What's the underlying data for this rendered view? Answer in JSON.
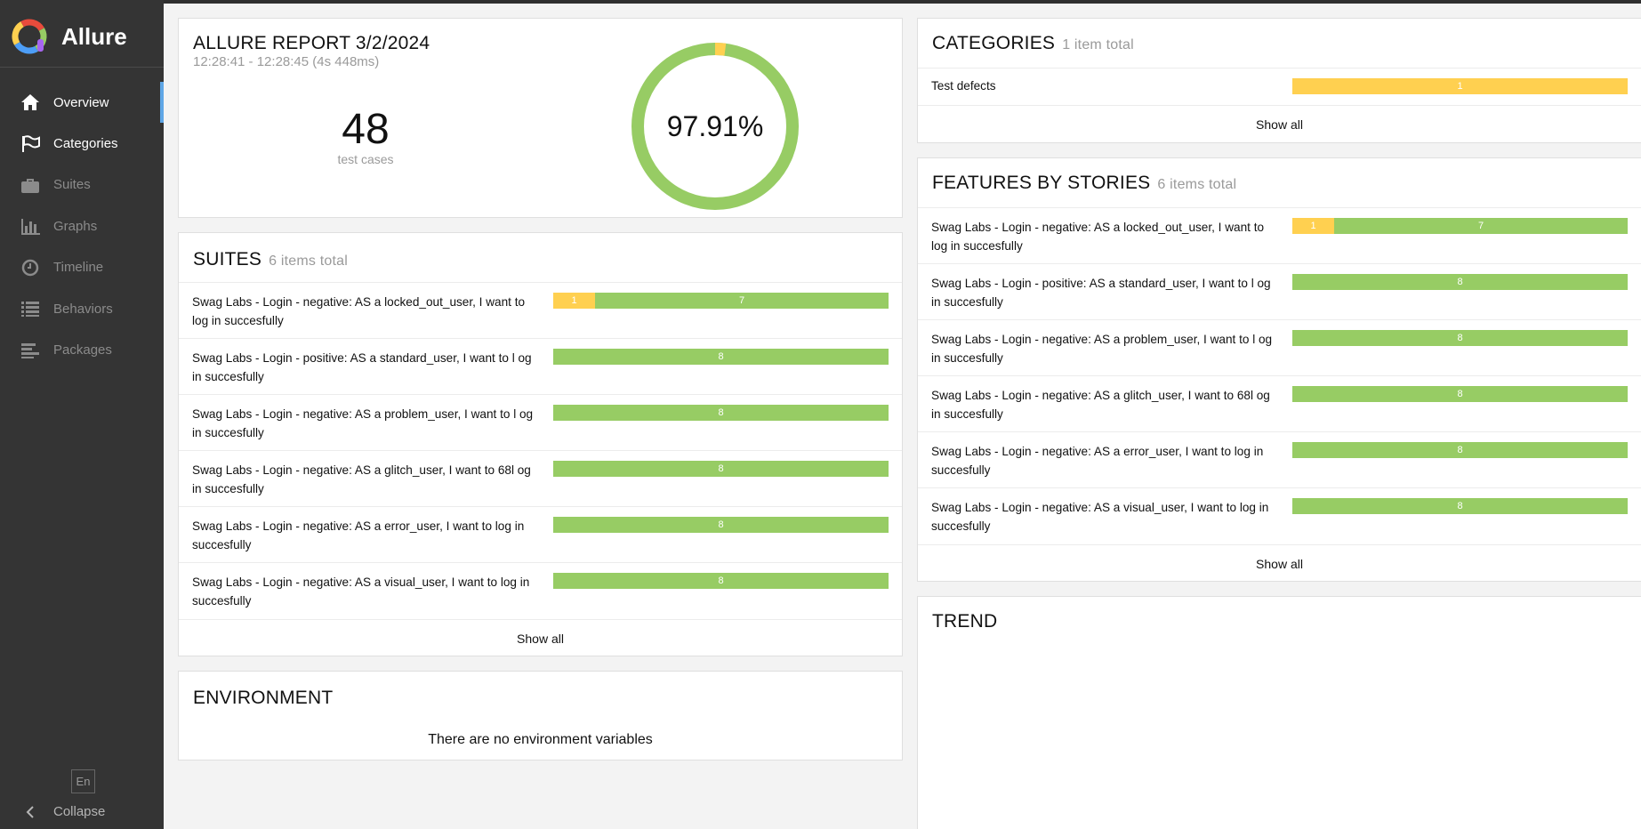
{
  "app": {
    "name": "Allure"
  },
  "sidebar": {
    "items": [
      {
        "label": "Overview",
        "icon": "home-icon"
      },
      {
        "label": "Categories",
        "icon": "flag-icon"
      },
      {
        "label": "Suites",
        "icon": "briefcase-icon"
      },
      {
        "label": "Graphs",
        "icon": "bar-chart-icon"
      },
      {
        "label": "Timeline",
        "icon": "clock-icon"
      },
      {
        "label": "Behaviors",
        "icon": "list-icon"
      },
      {
        "label": "Packages",
        "icon": "align-left-icon"
      }
    ],
    "language": "En",
    "collapse_label": "Collapse",
    "accent": "#5fa6e6"
  },
  "summary": {
    "title": "ALLURE REPORT 3/2/2024",
    "time_range": "12:28:41 - 12:28:45 (4s 448ms)",
    "count": "48",
    "count_label": "test cases",
    "percent": "97.91%",
    "passed_fraction": 0.9791
  },
  "suites": {
    "title": "SUITES",
    "subtitle": "6 items total",
    "rows": [
      {
        "label": "Swag Labs - Login - negative: AS a locked_out_user, I want to log in succesfully",
        "broken": 1,
        "passed": 7
      },
      {
        "label": "Swag Labs - Login - positive: AS a standard_user, I want to l og in succesfully",
        "broken": 0,
        "passed": 8
      },
      {
        "label": "Swag Labs - Login - negative: AS a problem_user, I want to l og in succesfully",
        "broken": 0,
        "passed": 8
      },
      {
        "label": "Swag Labs - Login - negative: AS a glitch_user, I want to 68l og in succesfully",
        "broken": 0,
        "passed": 8
      },
      {
        "label": "Swag Labs - Login - negative: AS a error_user, I want to log in succesfully",
        "broken": 0,
        "passed": 8
      },
      {
        "label": "Swag Labs - Login - negative: AS a visual_user, I want to log in succesfully",
        "broken": 0,
        "passed": 8
      }
    ],
    "show_all": "Show all"
  },
  "environment": {
    "title": "ENVIRONMENT",
    "empty_text": "There are no environment variables"
  },
  "categories": {
    "title": "CATEGORIES",
    "subtitle": "1 item total",
    "rows": [
      {
        "label": "Test defects",
        "broken": 1,
        "passed": 0
      }
    ],
    "show_all": "Show all"
  },
  "features": {
    "title": "FEATURES BY STORIES",
    "subtitle": "6 items total",
    "rows": [
      {
        "label": "Swag Labs - Login - negative: AS a locked_out_user, I want to log in succesfully",
        "broken": 1,
        "passed": 7
      },
      {
        "label": "Swag Labs - Login - positive: AS a standard_user, I want to l og in succesfully",
        "broken": 0,
        "passed": 8
      },
      {
        "label": "Swag Labs - Login - negative: AS a problem_user, I want to l og in succesfully",
        "broken": 0,
        "passed": 8
      },
      {
        "label": "Swag Labs - Login - negative: AS a glitch_user, I want to 68l og in succesfully",
        "broken": 0,
        "passed": 8
      },
      {
        "label": "Swag Labs - Login - negative: AS a error_user, I want to log in succesfully",
        "broken": 0,
        "passed": 8
      },
      {
        "label": "Swag Labs - Login - negative: AS a visual_user, I want to log in succesfully",
        "broken": 0,
        "passed": 8
      }
    ],
    "show_all": "Show all"
  },
  "trend": {
    "title": "TREND"
  },
  "colors": {
    "passed": "#97cc64",
    "broken": "#ffd050",
    "sidebar": "#343434"
  }
}
